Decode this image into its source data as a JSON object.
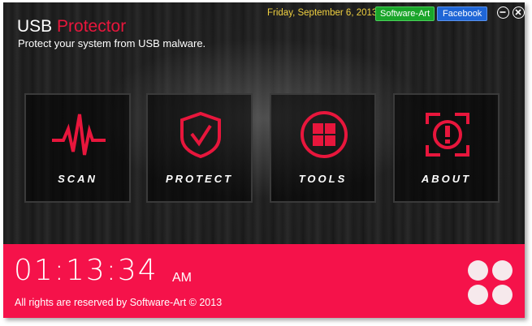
{
  "header": {
    "title_main": "USB",
    "title_accent": "Protector",
    "subtitle": "Protect your system from USB malware.",
    "date": "Friday, September 6, 2013",
    "software_art_label": "Software-Art",
    "facebook_label": "Facebook",
    "minimize_glyph": "⊖",
    "close_glyph": "✕"
  },
  "tiles": [
    {
      "label": "SCAN",
      "icon": "heartbeat-icon"
    },
    {
      "label": "PROTECT",
      "icon": "shield-check-icon"
    },
    {
      "label": "TOOLS",
      "icon": "grid-circle-icon"
    },
    {
      "label": "ABOUT",
      "icon": "info-alert-icon"
    }
  ],
  "footer": {
    "time": "01:13:34",
    "ampm": "AM",
    "copyright": "All rights are reserved by Software-Art © 2013"
  },
  "colors": {
    "accent": "#e8163c",
    "footer_bg": "#f5124a",
    "date": "#f0d040"
  }
}
